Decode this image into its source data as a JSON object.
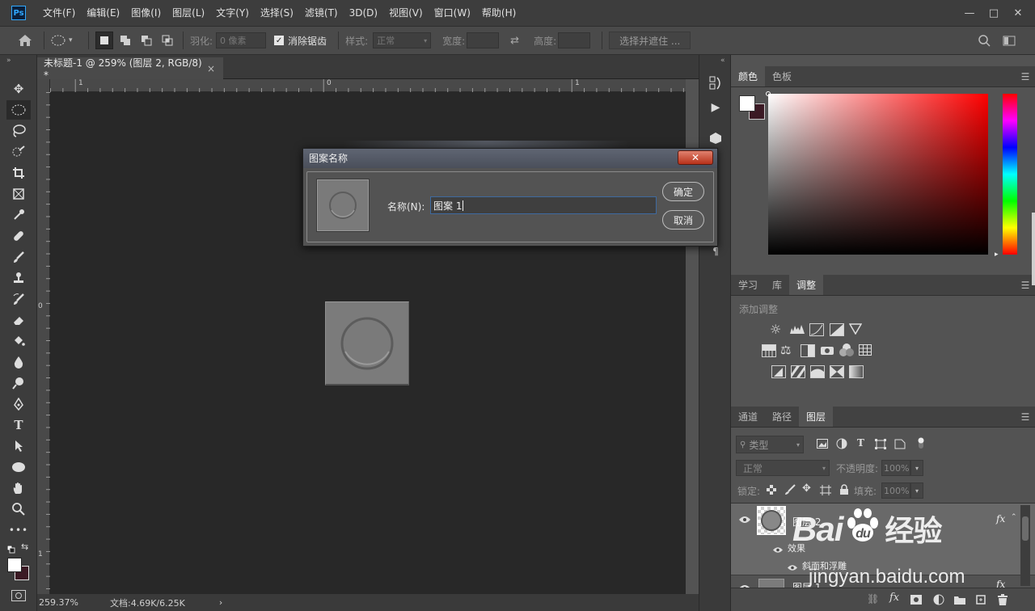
{
  "app": {
    "logo": "Ps"
  },
  "menu": [
    "文件(F)",
    "编辑(E)",
    "图像(I)",
    "图层(L)",
    "文字(Y)",
    "选择(S)",
    "滤镜(T)",
    "3D(D)",
    "视图(V)",
    "窗口(W)",
    "帮助(H)"
  ],
  "window_controls": {
    "minimize": "—",
    "maximize": "□",
    "close": "✕"
  },
  "options": {
    "feather_label": "羽化:",
    "feather_value": "0 像素",
    "antialias_label": "消除锯齿",
    "antialias_checked": true,
    "style_label": "样式:",
    "style_value": "正常",
    "width_label": "宽度:",
    "height_label": "高度:",
    "select_mask_label": "选择并遮住 ..."
  },
  "document": {
    "tab_title": "未标题-1 @ 259% (图层 2, RGB/8) *",
    "tab_close": "×",
    "ruler_h": [
      "1",
      "0",
      "1"
    ],
    "ruler_v": [
      "0",
      "1"
    ]
  },
  "status": {
    "zoom": "259.37%",
    "doc_info": "文档:4.69K/6.25K",
    "arrow": "›"
  },
  "dialog": {
    "title": "图案名称",
    "name_label": "名称(N):",
    "name_value": "图案 1",
    "ok": "确定",
    "cancel": "取消",
    "close": "✕"
  },
  "color_panel": {
    "tabs": [
      "颜色",
      "色板"
    ],
    "active": 0,
    "fg": "#ffffff",
    "bg": "#3b1a24"
  },
  "adjust_panel": {
    "tabs": [
      "学习",
      "库",
      "调整"
    ],
    "active": 2,
    "heading": "添加调整"
  },
  "layers_panel": {
    "tabs": [
      "通道",
      "路径",
      "图层"
    ],
    "active": 2,
    "filter_label": "类型",
    "blend_mode": "正常",
    "opacity_label": "不透明度:",
    "opacity_value": "100%",
    "lock_label": "锁定:",
    "fill_label": "填充:",
    "fill_value": "100%",
    "layers": [
      {
        "name": "图层 2",
        "fx": "fx",
        "effects_label": "效果",
        "effect": "斜面和浮雕"
      },
      {
        "name": "图层 1",
        "fx": "fx"
      }
    ]
  },
  "watermark": {
    "brand": "Bai",
    "brand2": "du",
    "brand_cn": "经验",
    "url": "jingyan.baidu.com"
  }
}
